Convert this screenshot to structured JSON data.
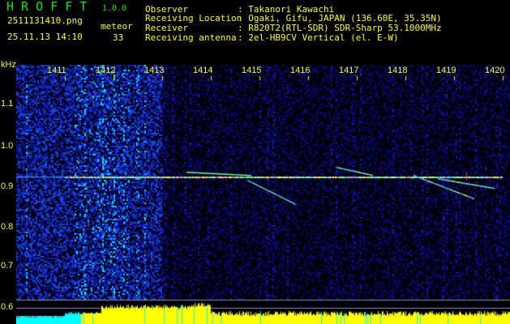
{
  "app": {
    "name": "H R O F F T",
    "version": "1.0.0"
  },
  "file": {
    "name": "2511131410.png",
    "datetime": "25.11.13 14:10"
  },
  "meteor": {
    "label": "meteor",
    "count": "33"
  },
  "info": [
    {
      "label": "Observer",
      "value": ": Takanori Kawachi"
    },
    {
      "label": "Receiving Location",
      "value": ": Ogaki, Gifu, JAPAN (136.60E, 35.35N)"
    },
    {
      "label": "Receiver",
      "value": ": R820T2(RTL-SDR) SDR-Sharp 53.1000MHz"
    },
    {
      "label": "Receiving antenna",
      "value": ": 2el-HB9CV Vertical (el. E-W)"
    }
  ],
  "spectrogram": {
    "y_unit": "kHz",
    "x_ticks": [
      "1411",
      "1412",
      "1413",
      "1414",
      "1415",
      "1416",
      "1417",
      "1418",
      "1419",
      "1420"
    ],
    "y_ticks": [
      "1.1",
      "1.0",
      "0.9",
      "0.8",
      "0.7",
      "0.6"
    ],
    "colors": {
      "text": "#ffff00",
      "logo": "#00ee00",
      "background": "#000010",
      "level": "#ffff00",
      "level_low": "#00ffff"
    }
  }
}
